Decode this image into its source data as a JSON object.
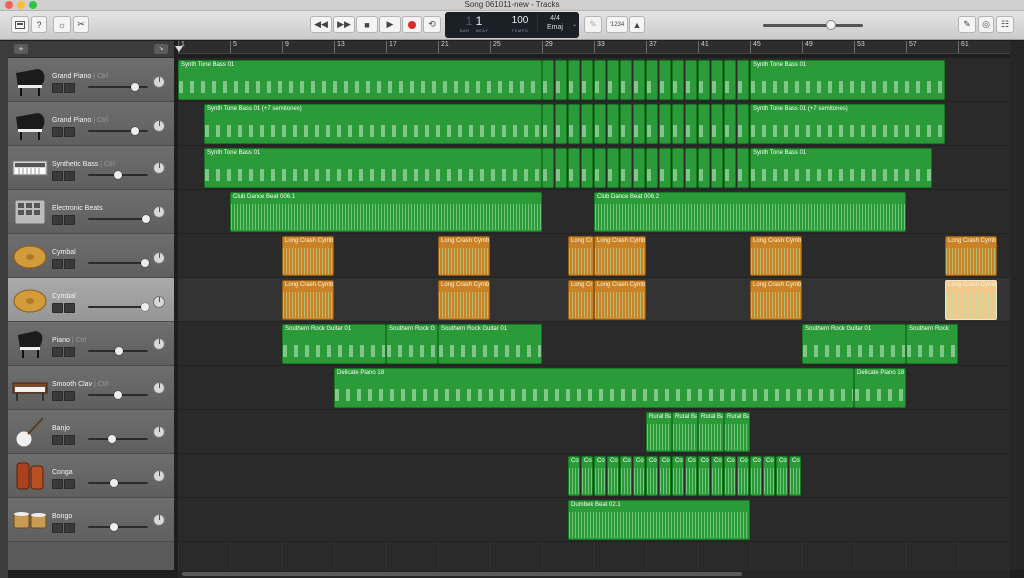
{
  "window": {
    "title": "Song 061011-new - Tracks"
  },
  "colors": {
    "green_region": "#2b9b3a",
    "orange_region": "#c98326",
    "record": "#e0272a"
  },
  "toolbar": {
    "left_icons": [
      "library-icon",
      "help-icon",
      "smart-controls-icon",
      "editors-icon"
    ],
    "transport": [
      "rewind-icon",
      "fast-forward-icon",
      "stop-icon",
      "play-icon",
      "record-icon",
      "cycle-icon"
    ],
    "lcd": {
      "bar": "1",
      "beat": "1",
      "bar_label": "BAR",
      "beat_label": "BEAT",
      "tempo": "100",
      "tempo_label": "TEMPO",
      "time_signature": "4/4",
      "key": "Emaj"
    },
    "count_in": "′1234",
    "master_volume_level": 0.68,
    "right_icons": [
      "notepad-icon",
      "loop-browser-icon",
      "media-browser-icon"
    ]
  },
  "ruler": {
    "bars": [
      "1",
      "5",
      "9",
      "13",
      "17",
      "21",
      "25",
      "29",
      "33",
      "37",
      "41",
      "45",
      "49",
      "53",
      "57",
      "61"
    ]
  },
  "tracks": [
    {
      "name": "Grand Piano",
      "suffix": "| Ctrl",
      "icon": "grand-piano-icon",
      "volume": 0.78,
      "selected": false
    },
    {
      "name": "Grand Piano",
      "suffix": "| Ctrl",
      "icon": "grand-piano-icon",
      "volume": 0.78,
      "selected": false
    },
    {
      "name": "Synthetic Bass",
      "suffix": "| Ctrl",
      "icon": "synth-keyboard-icon",
      "volume": 0.5,
      "selected": false
    },
    {
      "name": "Electronic Beats",
      "suffix": "",
      "icon": "drum-machine-icon",
      "volume": 0.96,
      "selected": false
    },
    {
      "name": "Cymbal",
      "suffix": "",
      "icon": "cymbal-icon",
      "volume": 0.95,
      "selected": false
    },
    {
      "name": "Cymbal",
      "suffix": "",
      "icon": "cymbal-icon",
      "volume": 0.95,
      "selected": true
    },
    {
      "name": "Piano",
      "suffix": "| Ctrl",
      "icon": "upright-piano-icon",
      "volume": 0.52,
      "selected": false
    },
    {
      "name": "Smooth Clav",
      "suffix": "| Ctrl",
      "icon": "clavinet-icon",
      "volume": 0.5,
      "selected": false
    },
    {
      "name": "Banjo",
      "suffix": "",
      "icon": "banjo-icon",
      "volume": 0.4,
      "selected": false
    },
    {
      "name": "Conga",
      "suffix": "",
      "icon": "conga-icon",
      "volume": 0.44,
      "selected": false
    },
    {
      "name": "Bongo",
      "suffix": "",
      "icon": "bongo-icon",
      "volume": 0.44,
      "selected": false
    }
  ],
  "regions": [
    {
      "track": 0,
      "start": 1,
      "end": 29,
      "label": "Synth Tone Bass 01",
      "kind": "midi",
      "color": "green"
    },
    {
      "track": 0,
      "start": 29,
      "end": 45,
      "label": "",
      "kind": "midi",
      "color": "green",
      "split": 16
    },
    {
      "track": 0,
      "start": 45,
      "end": 60,
      "label": "Synth Tone Bass 01",
      "kind": "midi",
      "color": "green"
    },
    {
      "track": 1,
      "start": 3,
      "end": 29,
      "label": "Synth Tone Bass 01 (+7 semitones)",
      "kind": "midi",
      "color": "green"
    },
    {
      "track": 1,
      "start": 29,
      "end": 45,
      "label": "",
      "kind": "midi",
      "color": "green",
      "split": 16
    },
    {
      "track": 1,
      "start": 45,
      "end": 60,
      "label": "Synth Tone Bass 01 (+7 semitones)",
      "kind": "midi",
      "color": "green"
    },
    {
      "track": 2,
      "start": 3,
      "end": 29,
      "label": "Synth Tone Bass 01",
      "kind": "midi",
      "color": "green"
    },
    {
      "track": 2,
      "start": 29,
      "end": 45,
      "label": "",
      "kind": "midi",
      "color": "green",
      "split": 16
    },
    {
      "track": 2,
      "start": 45,
      "end": 59,
      "label": "Synth Tone Bass 01",
      "kind": "midi",
      "color": "green"
    },
    {
      "track": 3,
      "start": 5,
      "end": 29,
      "label": "Club Dance Beat 006.1",
      "kind": "audio",
      "color": "green"
    },
    {
      "track": 3,
      "start": 33,
      "end": 57,
      "label": "Club Dance Beat 006.2",
      "kind": "audio",
      "color": "green"
    },
    {
      "track": 4,
      "start": 9,
      "end": 13,
      "label": "Long Crash Cymb",
      "kind": "audio",
      "color": "orange"
    },
    {
      "track": 4,
      "start": 21,
      "end": 25,
      "label": "Long Crash Cymb",
      "kind": "audio",
      "color": "orange"
    },
    {
      "track": 4,
      "start": 31,
      "end": 33,
      "label": "Long Cr",
      "kind": "audio",
      "color": "orange"
    },
    {
      "track": 4,
      "start": 33,
      "end": 37,
      "label": "Long Crash Cymb",
      "kind": "audio",
      "color": "orange"
    },
    {
      "track": 4,
      "start": 45,
      "end": 49,
      "label": "Long Crash Cymb",
      "kind": "audio",
      "color": "orange"
    },
    {
      "track": 4,
      "start": 60,
      "end": 64,
      "label": "Long Crash Cymb",
      "kind": "audio",
      "color": "orange"
    },
    {
      "track": 5,
      "start": 9,
      "end": 13,
      "label": "Long Crash Cymb",
      "kind": "audio",
      "color": "orange"
    },
    {
      "track": 5,
      "start": 21,
      "end": 25,
      "label": "Long Crash Cymb",
      "kind": "audio",
      "color": "orange"
    },
    {
      "track": 5,
      "start": 31,
      "end": 33,
      "label": "Long Cr",
      "kind": "audio",
      "color": "orange"
    },
    {
      "track": 5,
      "start": 33,
      "end": 37,
      "label": "Long Crash Cymb",
      "kind": "audio",
      "color": "orange"
    },
    {
      "track": 5,
      "start": 45,
      "end": 49,
      "label": "Long Crash Cymb",
      "kind": "audio",
      "color": "orange"
    },
    {
      "track": 5,
      "start": 60,
      "end": 64,
      "label": "Long Crash Cymb",
      "kind": "audio",
      "color": "orange",
      "selected": true
    },
    {
      "track": 6,
      "start": 9,
      "end": 17,
      "label": "Southern Rock Guitar 01",
      "kind": "midi",
      "color": "green"
    },
    {
      "track": 6,
      "start": 17,
      "end": 21,
      "label": "Southern Rock G",
      "kind": "midi",
      "color": "green"
    },
    {
      "track": 6,
      "start": 21,
      "end": 29,
      "label": "Southern Rock Guitar 01",
      "kind": "midi",
      "color": "green"
    },
    {
      "track": 6,
      "start": 49,
      "end": 57,
      "label": "Southern Rock Guitar 01",
      "kind": "midi",
      "color": "green"
    },
    {
      "track": 6,
      "start": 57,
      "end": 61,
      "label": "Southern Rock",
      "kind": "midi",
      "color": "green"
    },
    {
      "track": 7,
      "start": 13,
      "end": 53,
      "label": "Delicate Piano 18",
      "kind": "midi",
      "color": "green"
    },
    {
      "track": 7,
      "start": 53,
      "end": 57,
      "label": "Delicate Piano 18",
      "kind": "midi",
      "color": "green"
    },
    {
      "track": 8,
      "start": 37,
      "end": 39,
      "label": "Rural Ba",
      "kind": "audio",
      "color": "green"
    },
    {
      "track": 8,
      "start": 39,
      "end": 41,
      "label": "Rural Ba",
      "kind": "audio",
      "color": "green"
    },
    {
      "track": 8,
      "start": 41,
      "end": 43,
      "label": "Rural Ba",
      "kind": "audio",
      "color": "green"
    },
    {
      "track": 8,
      "start": 43,
      "end": 45,
      "label": "Rural Ba",
      "kind": "audio",
      "color": "green"
    },
    {
      "track": 9,
      "start": 31,
      "end": 49,
      "label": "Co",
      "kind": "audio",
      "color": "green",
      "chunks": 18
    },
    {
      "track": 10,
      "start": 31,
      "end": 45,
      "label": "Dumbek Beat 02.1",
      "kind": "audio",
      "color": "green"
    }
  ]
}
